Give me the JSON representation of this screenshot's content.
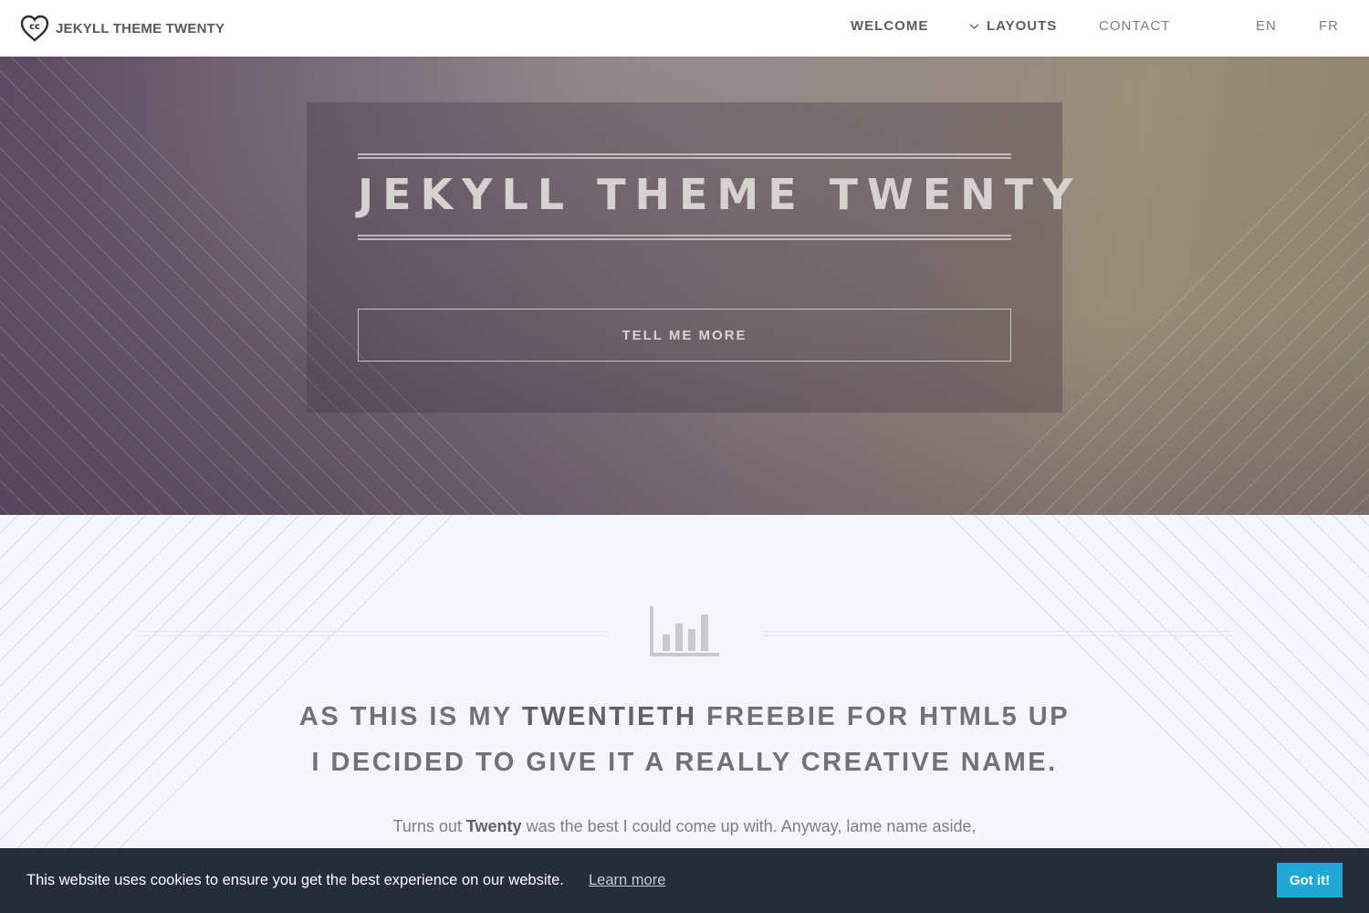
{
  "header": {
    "logo_text": "JEKYLL THEME TWENTY",
    "nav": {
      "welcome": "WELCOME",
      "layouts": "LAYOUTS",
      "contact": "CONTACT",
      "lang_en": "EN",
      "lang_fr": "FR"
    }
  },
  "hero": {
    "title": "JEKYLL THEME TWENTY",
    "button_label": "TELL ME MORE"
  },
  "main": {
    "icon": "bar-chart-icon",
    "headline_part1": "AS THIS IS MY ",
    "headline_bold": "TWENTIETH",
    "headline_part2": " FREEBIE FOR HTML5 UP",
    "headline_line2": "I DECIDED TO GIVE IT A REALLY CREATIVE NAME.",
    "body_part1": "Turns out ",
    "body_bold": "Twenty",
    "body_part2": " was the best I could come up with. Anyway, lame name aside,"
  },
  "cookie": {
    "message": "This website uses cookies to ensure you get the best experience on our website.",
    "link": "Learn more",
    "button": "Got it!"
  },
  "colors": {
    "accent": "#1fa7d6",
    "cookie_bg": "#262d3a",
    "page_bg": "#f3f6fa"
  }
}
